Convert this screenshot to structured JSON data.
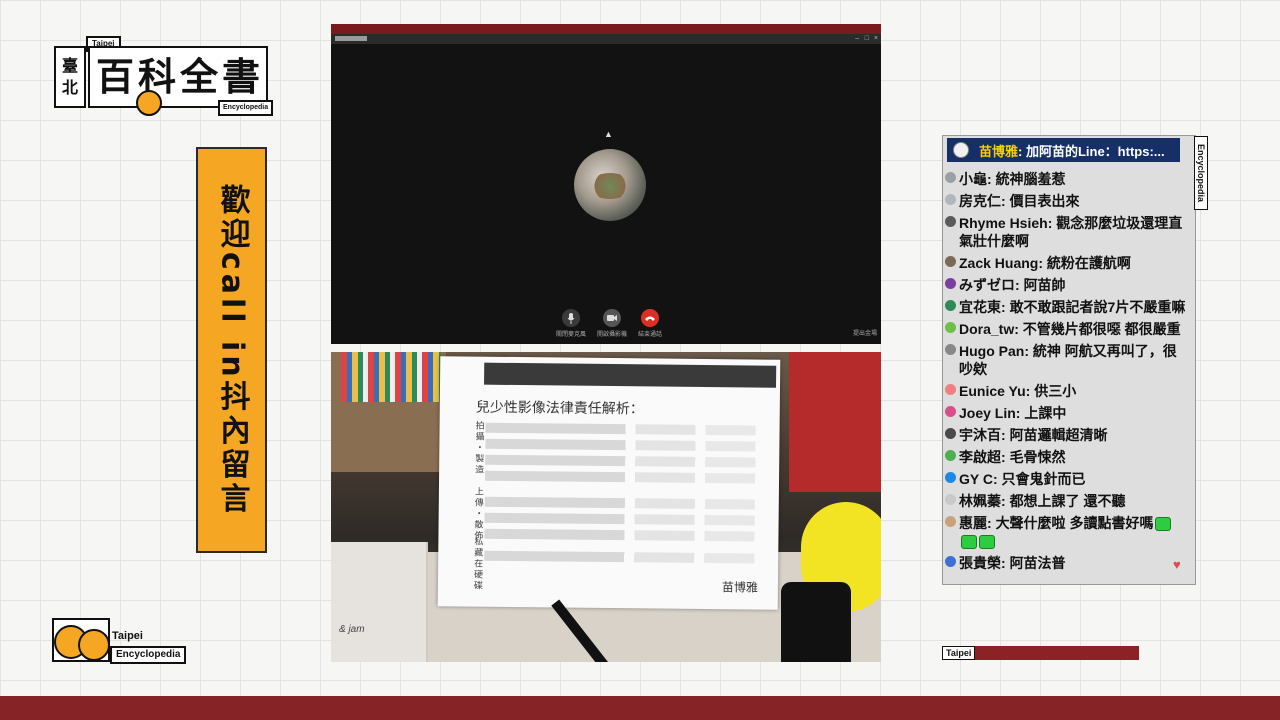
{
  "logo": {
    "left_char_1": "臺",
    "left_char_2": "北",
    "small_tag": "Taipei",
    "main_title": "百科全書",
    "sub_tag": "Encyclopedia"
  },
  "banner": {
    "text": "歡迎call in抖內留言"
  },
  "bottom_logo": {
    "line1": "Taipei",
    "line2": "Encyclopedia"
  },
  "video_call": {
    "controls": [
      {
        "label": "關閉麥克風",
        "icon": "microphone-icon",
        "color": "#3a3a3a"
      },
      {
        "label": "開啟攝影機",
        "icon": "camera-icon",
        "color": "#555555"
      },
      {
        "label": "結束通話",
        "icon": "hangup-icon",
        "color": "#d93025"
      }
    ],
    "more_label": "提出金場"
  },
  "camera": {
    "paper_title": "兒少性影像法律責任解析：",
    "row_labels": [
      "拍攝・製造",
      "上傳・散佈",
      "私藏在硬碟"
    ],
    "signature": "苗博雅",
    "handwriting": "& jam"
  },
  "chat": {
    "pinned": {
      "name": "苗博雅",
      "text": ": 加阿苗的Line：https:..."
    },
    "messages": [
      {
        "user": "小龜",
        "text": "統神腦羞惹",
        "avatar": "#9aa0a6"
      },
      {
        "user": "房克仁",
        "text": "價目表出來",
        "avatar": "#b0b6bb"
      },
      {
        "user": "Rhyme Hsieh",
        "text": "觀念那麼垃圾還理直氣壯什麼啊",
        "avatar": "#5a5a5a"
      },
      {
        "user": "Zack Huang",
        "text": "統粉在護航啊",
        "avatar": "#7a6a58"
      },
      {
        "user": "みずゼロ",
        "text": "阿苗帥",
        "avatar": "#7b3fa0"
      },
      {
        "user": "宜花東",
        "text": "敢不敢跟記者說7片不嚴重嘛",
        "avatar": "#2e8b57"
      },
      {
        "user": "Dora_tw",
        "text": "不管幾片都很噁 都很嚴重",
        "avatar": "#6cc04a"
      },
      {
        "user": "Hugo Pan",
        "text": "統神 阿航又再叫了，很吵欸",
        "avatar": "#888888"
      },
      {
        "user": "Eunice Yu",
        "text": "供三小",
        "avatar": "#f08080"
      },
      {
        "user": "Joey Lin",
        "text": "上課中",
        "avatar": "#d94f8a"
      },
      {
        "user": "宇沐百",
        "text": "阿苗邏輯超清晰",
        "avatar": "#4a4a4a"
      },
      {
        "user": "李啟超",
        "text": "毛骨悚然",
        "avatar": "#4caf50"
      },
      {
        "user": "GY C",
        "text": "只會鬼針而已",
        "avatar": "#1e88e5"
      },
      {
        "user": "林姵蓁",
        "text": "都想上課了 還不聽",
        "avatar": "#c9c9c9"
      },
      {
        "user": "惠麗",
        "text": "大聲什麼啦 多讀點書好嗎",
        "avatar": "#c8a27a",
        "emotes": 3
      },
      {
        "user": "張貴榮",
        "text": "阿苗法普",
        "avatar": "#3b6fd4"
      }
    ],
    "heart_icon": "heart-icon"
  },
  "side_tag": "Encyclopedia",
  "taipei_bar_label": "Taipei",
  "colors": {
    "accent_orange": "#f5a623",
    "brand_red": "#862326",
    "chat_pinned_bg": "#162f66",
    "chat_name_yellow": "#f5d100"
  }
}
